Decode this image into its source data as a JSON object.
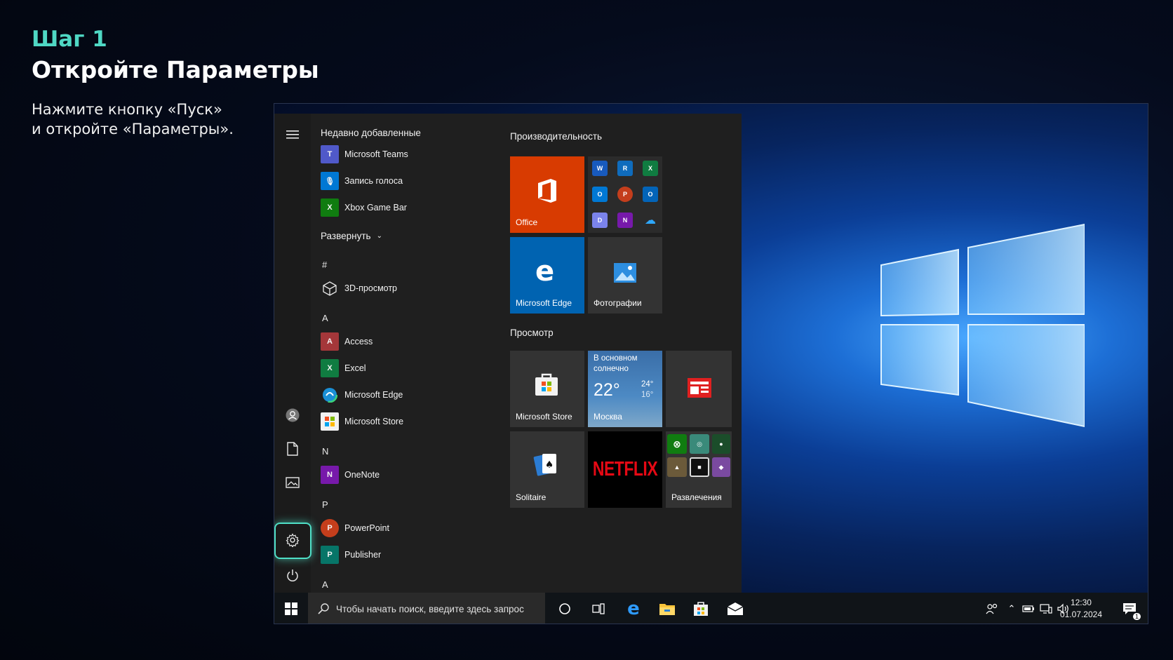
{
  "header": {
    "step": "Шаг 1",
    "title": "Откройте Параметры",
    "desc_line1": "Нажмите кнопку «Пуск»",
    "desc_line2": "и откройте «Параметры»."
  },
  "start_menu": {
    "recent_header": "Недавно добавленные",
    "recent": [
      {
        "label": "Microsoft Teams",
        "icon": "teams-icon",
        "color": "#5059c9"
      },
      {
        "label": "Запись голоса",
        "icon": "voice-recorder-icon",
        "color": "#0078d4"
      },
      {
        "label": "Xbox Game Bar",
        "icon": "xbox-game-bar-icon",
        "color": "#107c10"
      }
    ],
    "expand_label": "Развернуть",
    "letters": {
      "hash": "#",
      "a": "A",
      "n": "N",
      "p": "P",
      "last": "А"
    },
    "apps": {
      "view3d": "3D-просмотр",
      "access": "Access",
      "excel": "Excel",
      "edge": "Microsoft Edge",
      "store": "Microsoft Store",
      "onenote": "OneNote",
      "powerpoint": "PowerPoint",
      "publisher": "Publisher"
    },
    "groups": {
      "productivity": "Производительность",
      "browse": "Просмотр"
    },
    "tiles": {
      "office": "Office",
      "edge": "Microsoft Edge",
      "photos": "Фотографии",
      "store": "Microsoft Store",
      "weather_desc_1": "В основном",
      "weather_desc_2": "солнечно",
      "weather_temp": "22°",
      "weather_high": "24°",
      "weather_low": "16°",
      "weather_city": "Москва",
      "solitaire": "Solitaire",
      "netflix": "NETFLIX",
      "entertainment": "Развлечения"
    }
  },
  "taskbar": {
    "search_placeholder": "Чтобы начать поиск, введите здесь запрос",
    "time": "12:30",
    "date": "01.07.2024",
    "notification_count": "1"
  },
  "colors": {
    "accent": "#4fe0c7",
    "office": "#d83b01",
    "edge_tile": "#0063b1",
    "weather": "#3b77b5"
  }
}
